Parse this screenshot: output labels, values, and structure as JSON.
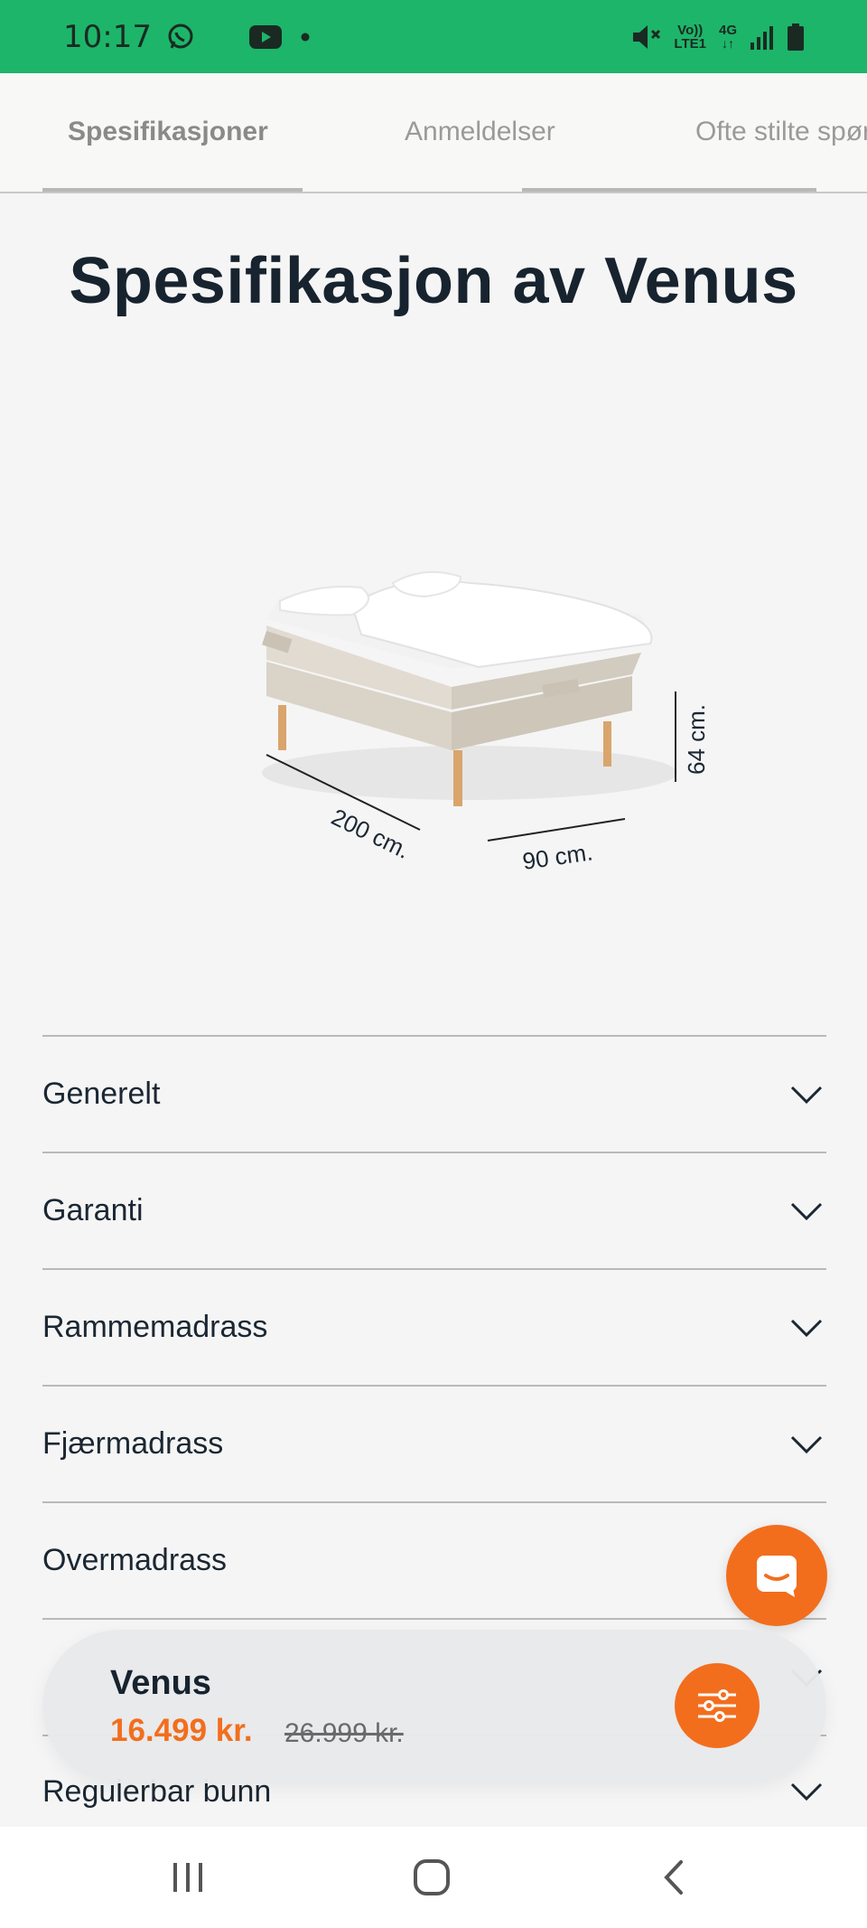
{
  "status_bar": {
    "time": "10:17",
    "network_top": "Vo))",
    "network_bottom": "LTE1",
    "network_type": "4G",
    "icons": [
      "whatsapp-icon",
      "youtube-icon",
      "dot-icon",
      "mute-icon",
      "signal-icon",
      "battery-icon"
    ]
  },
  "tabs": [
    {
      "label": "Spesifikasjoner",
      "active": true
    },
    {
      "label": "Anmeldelser",
      "active": false
    },
    {
      "label": "Ofte stilte spørsmål",
      "active": false
    }
  ],
  "page_title": "Spesifikasjon av Venus",
  "product_image": {
    "height_label": "64 cm.",
    "length_label": "200 cm.",
    "width_label": "90 cm."
  },
  "accordion": [
    {
      "label": "Generelt"
    },
    {
      "label": "Garanti"
    },
    {
      "label": "Rammemadrass"
    },
    {
      "label": "Fjærmadrass"
    },
    {
      "label": "Overmadrass"
    },
    {
      "label": "Regulerbar bunn"
    }
  ],
  "sticky_bar": {
    "product_name": "Venus",
    "price": "16.499 kr.",
    "old_price": "26.999 kr."
  },
  "colors": {
    "status_bar": "#1db56a",
    "accent": "#f26e1d",
    "title": "#17232e"
  },
  "nav_bar": {
    "icons": [
      "recent-apps-icon",
      "home-icon",
      "back-icon"
    ]
  }
}
